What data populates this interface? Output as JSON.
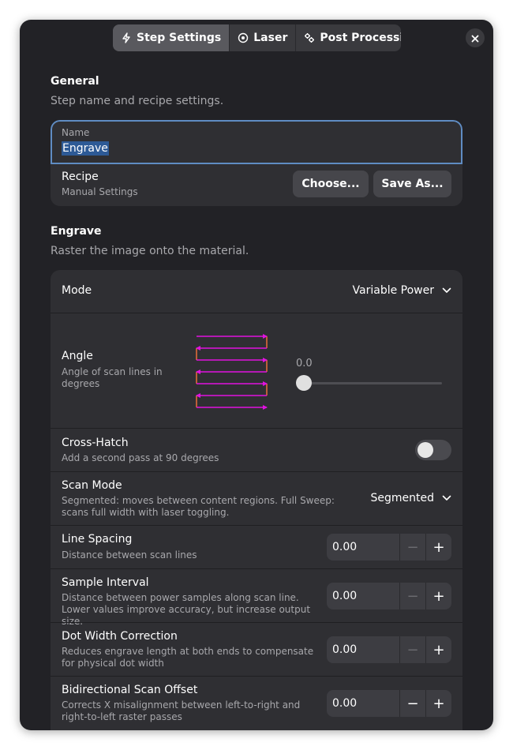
{
  "tabs": [
    {
      "label": "Step Settings",
      "icon": "lightning-icon",
      "active": true
    },
    {
      "label": "Laser",
      "icon": "target-icon",
      "active": false
    },
    {
      "label": "Post Processing",
      "icon": "gears-icon",
      "active": false
    }
  ],
  "close_icon": "close-icon",
  "general": {
    "title": "General",
    "description": "Step name and recipe settings.",
    "name_label": "Name",
    "name_value": "Engrave",
    "recipe_title": "Recipe",
    "recipe_sub": "Manual Settings",
    "choose_label": "Choose...",
    "save_as_label": "Save As..."
  },
  "engrave": {
    "title": "Engrave",
    "description": "Raster the image onto the material.",
    "mode_label": "Mode",
    "mode_value": "Variable Power",
    "angle_title": "Angle",
    "angle_sub": "Angle of scan lines in degrees",
    "angle_value": "0.0",
    "crosshatch_title": "Cross-Hatch",
    "crosshatch_sub": "Add a second pass at 90 degrees",
    "crosshatch_on": false,
    "scan_mode_title": "Scan Mode",
    "scan_mode_sub": "Segmented: moves between content regions. Full Sweep: scans full width with laser toggling.",
    "scan_mode_value": "Segmented",
    "line_spacing_title": "Line Spacing",
    "line_spacing_sub": "Distance between scan lines",
    "line_spacing_value": "0.00",
    "sample_interval_title": "Sample Interval",
    "sample_interval_sub": "Distance between power samples along scan line. Lower values improve accuracy, but increase output size.",
    "sample_interval_value": "0.00",
    "dot_width_title": "Dot Width Correction",
    "dot_width_sub": "Reduces engrave length at both ends to compensate for physical dot width",
    "dot_width_value": "0.00",
    "bidir_title": "Bidirectional Scan Offset",
    "bidir_sub": "Corrects X misalignment between left-to-right and right-to-left raster passes",
    "bidir_value": "0.00"
  },
  "colors": {
    "background": "#222226",
    "card": "#2f2f33",
    "accent_border": "#5f8cc3",
    "selection": "#2d5a96",
    "scan_line": "#e012e0",
    "scan_connector": "#e06a3a"
  }
}
